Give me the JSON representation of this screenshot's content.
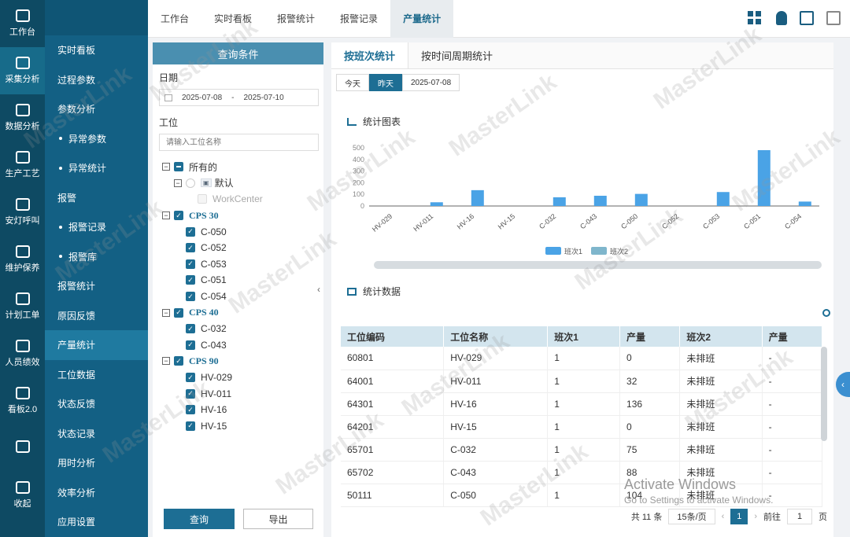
{
  "rail": [
    {
      "label": "工作台",
      "icon": "monitor-icon"
    },
    {
      "label": "采集分析",
      "icon": "chart-icon",
      "active": true
    },
    {
      "label": "数据分析",
      "icon": "graph-icon"
    },
    {
      "label": "生产工艺",
      "icon": "gear-icon"
    },
    {
      "label": "安灯呼叫",
      "icon": "bell-icon"
    },
    {
      "label": "维护保养",
      "icon": "wrench-icon"
    },
    {
      "label": "计划工单",
      "icon": "list-icon"
    },
    {
      "label": "人员绩效",
      "icon": "user-icon"
    },
    {
      "label": "看板2.0",
      "icon": "board-icon"
    },
    {
      "label": "",
      "icon": "bars-icon"
    },
    {
      "label": "收起",
      "icon": "collapse-icon"
    }
  ],
  "submenu": [
    {
      "label": "实时看板",
      "sub": false
    },
    {
      "label": "过程参数",
      "sub": false
    },
    {
      "label": "参数分析",
      "sub": false
    },
    {
      "label": "异常参数",
      "sub": true
    },
    {
      "label": "异常统计",
      "sub": true
    },
    {
      "label": "报警",
      "sub": false
    },
    {
      "label": "报警记录",
      "sub": true
    },
    {
      "label": "报警库",
      "sub": true
    },
    {
      "label": "报警统计",
      "sub": false
    },
    {
      "label": "原因反馈",
      "sub": false
    },
    {
      "label": "产量统计",
      "sub": false,
      "active": true
    },
    {
      "label": "工位数据",
      "sub": false
    },
    {
      "label": "状态反馈",
      "sub": false
    },
    {
      "label": "状态记录",
      "sub": false
    },
    {
      "label": "用时分析",
      "sub": false
    },
    {
      "label": "效率分析",
      "sub": false
    },
    {
      "label": "应用设置",
      "sub": false
    }
  ],
  "top_tabs": [
    "工作台",
    "实时看板",
    "报警统计",
    "报警记录",
    "产量统计"
  ],
  "top_active": 4,
  "filter": {
    "title": "查询条件",
    "date_label": "日期",
    "date_start": "2025-07-08",
    "date_sep": "-",
    "date_end": "2025-07-10",
    "station_label": "工位",
    "search_placeholder": "请输入工位名称",
    "query_btn": "查询",
    "export_btn": "导出"
  },
  "tree": [
    {
      "depth": 0,
      "toggle": "⊟",
      "cb": "part",
      "label": "所有的"
    },
    {
      "depth": 1,
      "toggle": "⊟",
      "cb": "off",
      "tag": "默认",
      "label": "默认"
    },
    {
      "depth": 2,
      "cb": "dis",
      "label": "WorkCenter",
      "disabled": true
    },
    {
      "depth": 0,
      "toggle": "⊟",
      "cb": "on",
      "label": "CPS 30",
      "bold": true
    },
    {
      "depth": 1,
      "cb": "on",
      "label": "C-050"
    },
    {
      "depth": 1,
      "cb": "on",
      "label": "C-052"
    },
    {
      "depth": 1,
      "cb": "on",
      "label": "C-053"
    },
    {
      "depth": 1,
      "cb": "on",
      "label": "C-051"
    },
    {
      "depth": 1,
      "cb": "on",
      "label": "C-054"
    },
    {
      "depth": 0,
      "toggle": "⊟",
      "cb": "on",
      "label": "CPS 40",
      "bold": true
    },
    {
      "depth": 1,
      "cb": "on",
      "label": "C-032"
    },
    {
      "depth": 1,
      "cb": "on",
      "label": "C-043"
    },
    {
      "depth": 0,
      "toggle": "⊟",
      "cb": "on",
      "label": "CPS 90",
      "bold": true
    },
    {
      "depth": 1,
      "cb": "on",
      "label": "HV-029"
    },
    {
      "depth": 1,
      "cb": "on",
      "label": "HV-011"
    },
    {
      "depth": 1,
      "cb": "on",
      "label": "HV-16"
    },
    {
      "depth": 1,
      "cb": "on",
      "label": "HV-15"
    }
  ],
  "main": {
    "tabs": [
      "按班次统计",
      "按时间周期统计"
    ],
    "ranges": [
      "今天",
      "昨天",
      "2025-07-08"
    ],
    "range_active": 1,
    "chart_title": "统计图表",
    "table_title": "统计数据",
    "headers": [
      "工位编码",
      "工位名称",
      "班次1",
      "产量",
      "班次2",
      "产量"
    ],
    "rows": [
      [
        "60801",
        "HV-029",
        "1",
        "0",
        "未排班",
        "-"
      ],
      [
        "64001",
        "HV-011",
        "1",
        "32",
        "未排班",
        "-"
      ],
      [
        "64301",
        "HV-16",
        "1",
        "136",
        "未排班",
        "-"
      ],
      [
        "64201",
        "HV-15",
        "1",
        "0",
        "未排班",
        "-"
      ],
      [
        "65701",
        "C-032",
        "1",
        "75",
        "未排班",
        "-"
      ],
      [
        "65702",
        "C-043",
        "1",
        "88",
        "未排班",
        "-"
      ],
      [
        "50111",
        "C-050",
        "1",
        "104",
        "未排班",
        "-"
      ]
    ],
    "pager": {
      "total": "共 11 条",
      "size": "15条/页",
      "current": "1",
      "goto": "前往",
      "goto_value": "1",
      "page_unit": "页"
    }
  },
  "chart_data": {
    "type": "bar",
    "categories": [
      "HV-029",
      "HV-011",
      "HV-16",
      "HV-15",
      "C-032",
      "C-043",
      "C-050",
      "C-052",
      "C-053",
      "C-051",
      "C-054"
    ],
    "series": [
      {
        "name": "班次1",
        "values": [
          0,
          32,
          136,
          0,
          75,
          88,
          104,
          0,
          120,
          480,
          38
        ],
        "color": "#4aa3e6"
      },
      {
        "name": "班次2",
        "values": [
          0,
          0,
          0,
          0,
          0,
          0,
          0,
          0,
          0,
          0,
          0
        ],
        "color": "#7fb6cc"
      }
    ],
    "yticks": [
      0,
      100,
      200,
      300,
      400,
      500
    ],
    "ylim": [
      0,
      500
    ],
    "legend_position": "bottom"
  },
  "watermark": "MasterLink",
  "windows_notice": {
    "line1": "Activate Windows",
    "line2": "Go to Settings to activate Windows."
  }
}
